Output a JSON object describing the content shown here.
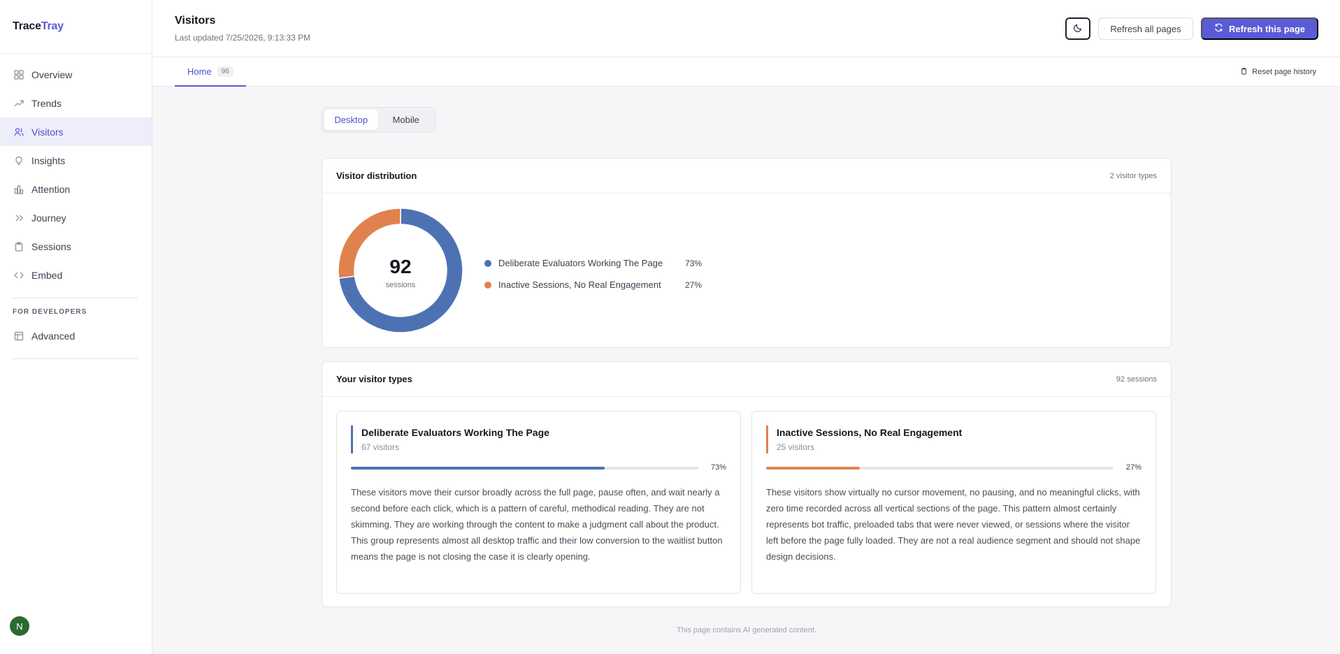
{
  "brand": {
    "part1": "Trace",
    "part2": "Tray",
    "accent": "#5a5bd6"
  },
  "sidebar": {
    "items": [
      {
        "label": "Overview",
        "icon": "grid-icon"
      },
      {
        "label": "Trends",
        "icon": "trend-up-icon"
      },
      {
        "label": "Visitors",
        "icon": "users-icon",
        "active": true
      },
      {
        "label": "Insights",
        "icon": "lightbulb-icon"
      },
      {
        "label": "Attention",
        "icon": "bar-chart-icon"
      },
      {
        "label": "Journey",
        "icon": "chevrons-right-icon"
      },
      {
        "label": "Sessions",
        "icon": "clipboard-icon"
      },
      {
        "label": "Embed",
        "icon": "code-icon"
      }
    ],
    "section_label": "FOR DEVELOPERS",
    "dev_items": [
      {
        "label": "Advanced",
        "icon": "table-icon"
      }
    ],
    "avatar_initial": "N"
  },
  "header": {
    "title": "Visitors",
    "updated": "Last updated 7/25/2026, 9:13:33 PM",
    "theme_icon": "moon-icon",
    "refresh_all_label": "Refresh all pages",
    "refresh_this_label": "Refresh this page"
  },
  "tabs": [
    {
      "label": "Home",
      "count": "96"
    }
  ],
  "reset_label": "Reset page history",
  "device_toggle": {
    "options": [
      "Desktop",
      "Mobile"
    ],
    "selected": "Desktop"
  },
  "distribution": {
    "title": "Visitor distribution",
    "meta": "2 visitor types",
    "total": "92",
    "total_label": "sessions"
  },
  "chart_data": {
    "type": "pie",
    "categories": [
      "Deliberate Evaluators Working The Page",
      "Inactive Sessions, No Real Engagement"
    ],
    "values": [
      73,
      27
    ],
    "labels": [
      "73%",
      "27%"
    ],
    "colors": [
      "#4d72b4",
      "#e0824e"
    ]
  },
  "visitor_types": {
    "title": "Your visitor types",
    "meta": "92 sessions",
    "cards": [
      {
        "name": "Deliberate Evaluators Working The Page",
        "count": "67 visitors",
        "pct": "73%",
        "fill": 0.73,
        "color": "#4d72b4",
        "description": "These visitors move their cursor broadly across the full page, pause often, and wait nearly a second before each click, which is a pattern of careful, methodical reading. They are not skimming. They are working through the content to make a judgment call about the product. This group represents almost all desktop traffic and their low conversion to the waitlist button means the page is not closing the case it is clearly opening."
      },
      {
        "name": "Inactive Sessions, No Real Engagement",
        "count": "25 visitors",
        "pct": "27%",
        "fill": 0.27,
        "color": "#e0824e",
        "description": "These visitors show virtually no cursor movement, no pausing, and no meaningful clicks, with zero time recorded across all vertical sections of the page. This pattern almost certainly represents bot traffic, preloaded tabs that were never viewed, or sessions where the visitor left before the page fully loaded. They are not a real audience segment and should not shape design decisions."
      }
    ]
  },
  "footer_note": "This page contains AI generated content."
}
